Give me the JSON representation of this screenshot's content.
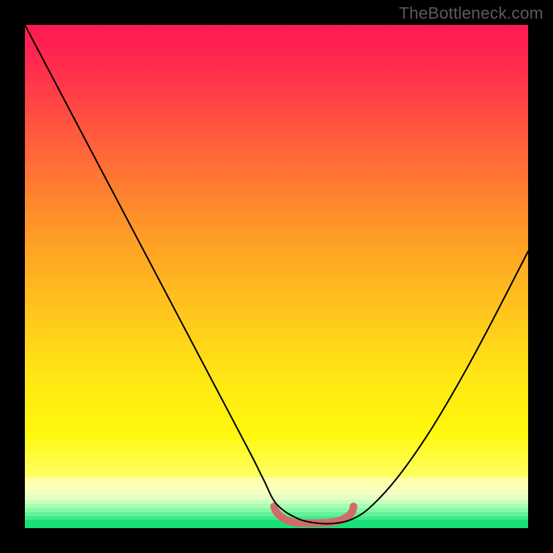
{
  "watermark": "TheBottleneck.com",
  "chart_data": {
    "type": "line",
    "title": "",
    "xlabel": "",
    "ylabel": "",
    "xlim": [
      0,
      1
    ],
    "ylim": [
      0,
      1
    ],
    "series": [
      {
        "name": "bottleneck-curve",
        "x": [
          0.0,
          0.05,
          0.1,
          0.15,
          0.2,
          0.25,
          0.3,
          0.35,
          0.4,
          0.45,
          0.475,
          0.5,
          0.54,
          0.58,
          0.62,
          0.655,
          0.69,
          0.74,
          0.8,
          0.86,
          0.92,
          1.0
        ],
        "values": [
          1.0,
          0.905,
          0.81,
          0.715,
          0.62,
          0.525,
          0.43,
          0.335,
          0.24,
          0.145,
          0.095,
          0.048,
          0.02,
          0.01,
          0.01,
          0.02,
          0.045,
          0.1,
          0.185,
          0.285,
          0.395,
          0.55
        ]
      },
      {
        "name": "bottom-marker",
        "x": [
          0.495,
          0.5,
          0.51,
          0.525,
          0.545,
          0.565,
          0.585,
          0.605,
          0.625,
          0.64,
          0.65,
          0.653
        ],
        "values": [
          0.043,
          0.032,
          0.022,
          0.014,
          0.01,
          0.01,
          0.01,
          0.011,
          0.015,
          0.022,
          0.032,
          0.043
        ]
      }
    ],
    "gradient_bands": [
      {
        "top": 0.0,
        "height": 0.9,
        "gradient": [
          {
            "stop": 0.0,
            "color": "#ff1a53"
          },
          {
            "stop": 0.06,
            "color": "#ff2450"
          },
          {
            "stop": 0.14,
            "color": "#ff3b49"
          },
          {
            "stop": 0.24,
            "color": "#ff5a3e"
          },
          {
            "stop": 0.36,
            "color": "#ff7e30"
          },
          {
            "stop": 0.5,
            "color": "#ffa524"
          },
          {
            "stop": 0.64,
            "color": "#ffc71c"
          },
          {
            "stop": 0.78,
            "color": "#ffe714"
          },
          {
            "stop": 0.9,
            "color": "#fff80c"
          },
          {
            "stop": 1.0,
            "color": "#ffff66"
          }
        ]
      },
      {
        "top": 0.9,
        "height": 0.02,
        "color": "#ffffb0"
      },
      {
        "top": 0.92,
        "height": 0.014,
        "color": "#f6ffc2"
      },
      {
        "top": 0.934,
        "height": 0.01,
        "color": "#e4ffc2"
      },
      {
        "top": 0.944,
        "height": 0.008,
        "color": "#c8ffbf"
      },
      {
        "top": 0.952,
        "height": 0.008,
        "color": "#a8ffb4"
      },
      {
        "top": 0.96,
        "height": 0.008,
        "color": "#86f9a7"
      },
      {
        "top": 0.968,
        "height": 0.008,
        "color": "#62f198"
      },
      {
        "top": 0.976,
        "height": 0.008,
        "color": "#3fe989"
      },
      {
        "top": 0.984,
        "height": 0.016,
        "color": "#18df77"
      }
    ],
    "styles": {
      "curve_stroke": "#000000",
      "curve_width": 2.2,
      "marker_stroke": "#d36a6a",
      "marker_width": 11
    }
  }
}
